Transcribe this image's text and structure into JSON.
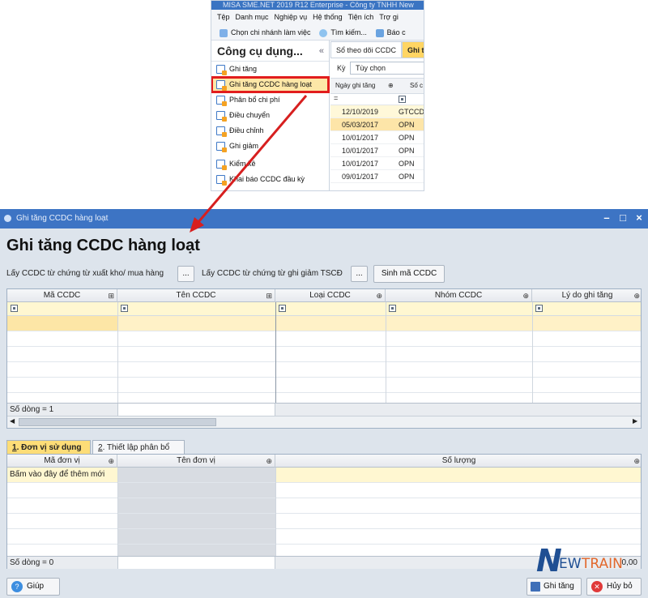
{
  "top_screenshot": {
    "app_title": "MISA SME.NET 2019 R12 Enterprise - Công ty TNHH New",
    "menu": [
      "Tệp",
      "Danh mục",
      "Nghiệp vụ",
      "Hệ thống",
      "Tiện ích",
      "Trợ gi"
    ],
    "toolbar": {
      "branch": "Chọn chi nhánh làm việc",
      "search": "Tìm kiếm...",
      "report": "Báo c"
    },
    "left_panel": {
      "title": "Công cụ dụng...",
      "collapse": "«",
      "items": [
        "Ghi tăng",
        "Ghi tăng CCDC hàng loạt",
        "Phân bổ chi phí",
        "Điều chuyển",
        "Điều chỉnh",
        "Ghi giảm",
        "Kiểm kê",
        "Khai báo CCDC đầu kỳ"
      ]
    },
    "tabs": [
      "Sổ theo dõi CCDC",
      "Ghi t"
    ],
    "ky_label": "Kỳ",
    "ky_value": "Tùy chọn",
    "grid_headers": [
      "Ngày ghi tăng",
      "Số c"
    ],
    "rows": [
      {
        "date": "12/10/2019",
        "code": "GTCCD"
      },
      {
        "date": "05/03/2017",
        "code": "OPN"
      },
      {
        "date": "10/01/2017",
        "code": "OPN"
      },
      {
        "date": "10/01/2017",
        "code": "OPN"
      },
      {
        "date": "10/01/2017",
        "code": "OPN"
      },
      {
        "date": "09/01/2017",
        "code": "OPN"
      }
    ]
  },
  "window": {
    "title": "Ghi tăng CCDC hàng loạt",
    "controls": {
      "minimize": "–",
      "maximize": "□",
      "close": "×"
    },
    "heading": "Ghi tăng CCDC hàng loạt",
    "toolbar": {
      "from_export_label": "Lấy CCDC từ chứng từ xuất kho/ mua hàng",
      "ellipsis": "...",
      "from_reduce_label": "Lấy CCDC từ chứng từ ghi giảm TSCĐ",
      "gen_code_button": "Sinh mã CCDC"
    },
    "grid1": {
      "columns": [
        "Mã CCDC",
        "Tên CCDC",
        "Loại CCDC",
        "Nhóm CCDC",
        "Lý do ghi tăng"
      ],
      "footer": "Số dòng = 1"
    },
    "tabs": [
      {
        "num": "1",
        "rest": ". Đơn vị sử dụng",
        "active": true
      },
      {
        "num": "2",
        "rest": ". Thiết lập phân bổ",
        "active": false
      }
    ],
    "grid2": {
      "columns": [
        "Mã đơn vị",
        "Tên đơn vị",
        "Số lượng"
      ],
      "add_hint": "Bấm vào đây để thêm mới",
      "footer": "Số dòng = 0",
      "total": "0,00"
    },
    "bottom": {
      "help": "Giúp",
      "save": "Ghi tăng",
      "cancel": "Hủy bỏ"
    },
    "watermark": {
      "n": "N",
      "ew": "EW",
      "train": "TRAIN"
    }
  },
  "colors": {
    "accent": "#3d74c4",
    "highlight": "#e21d1d",
    "row_yellow": "#fff7d1"
  }
}
